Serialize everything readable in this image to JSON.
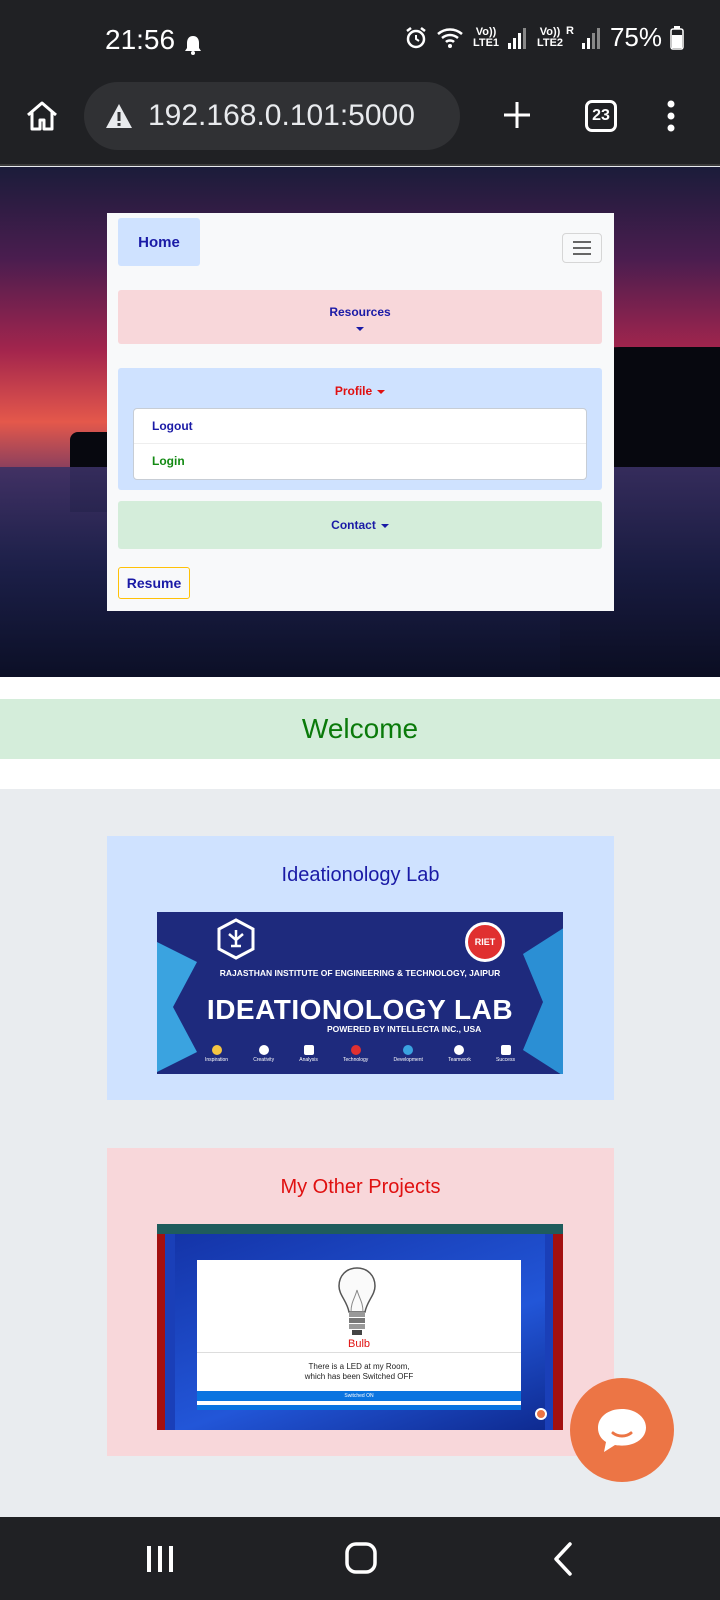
{
  "status_bar": {
    "time": "21:56",
    "battery": "75%",
    "sim1": "Vo)) LTE1",
    "sim2": "Vo)) LTE2",
    "roaming": "R"
  },
  "browser": {
    "url": "192.168.0.101:5000",
    "tab_count": "23"
  },
  "nav": {
    "home": "Home",
    "resources": "Resources",
    "profile": "Profile",
    "profile_items": [
      "Logout",
      "Login"
    ],
    "contact": "Contact",
    "resume": "Resume"
  },
  "welcome": "Welcome",
  "lab_card": {
    "title": "Ideationology Lab",
    "banner_institute": "RAJASTHAN INSTITUTE OF ENGINEERING & TECHNOLOGY, JAIPUR",
    "banner_title": "IDEATIONOLOGY LAB",
    "banner_powered": "POWERED BY INTELLECTA INC., USA",
    "banner_badge": "RIET",
    "banner_icons": [
      "Inspiration",
      "Creativity",
      "Analysis",
      "Technology",
      "Development",
      "Teamwork",
      "Success"
    ]
  },
  "projects_card": {
    "title": "My Other Projects",
    "bulb_label": "Bulb",
    "bulb_text_1": "There is a LED at my Room,",
    "bulb_text_2": "which has been Switched OFF",
    "bulb_button": "Switched ON"
  },
  "colors": {
    "accent_orange": "#ec7545",
    "welcome_green": "#0a7a0a",
    "lab_blue": "#1e2a7d"
  }
}
